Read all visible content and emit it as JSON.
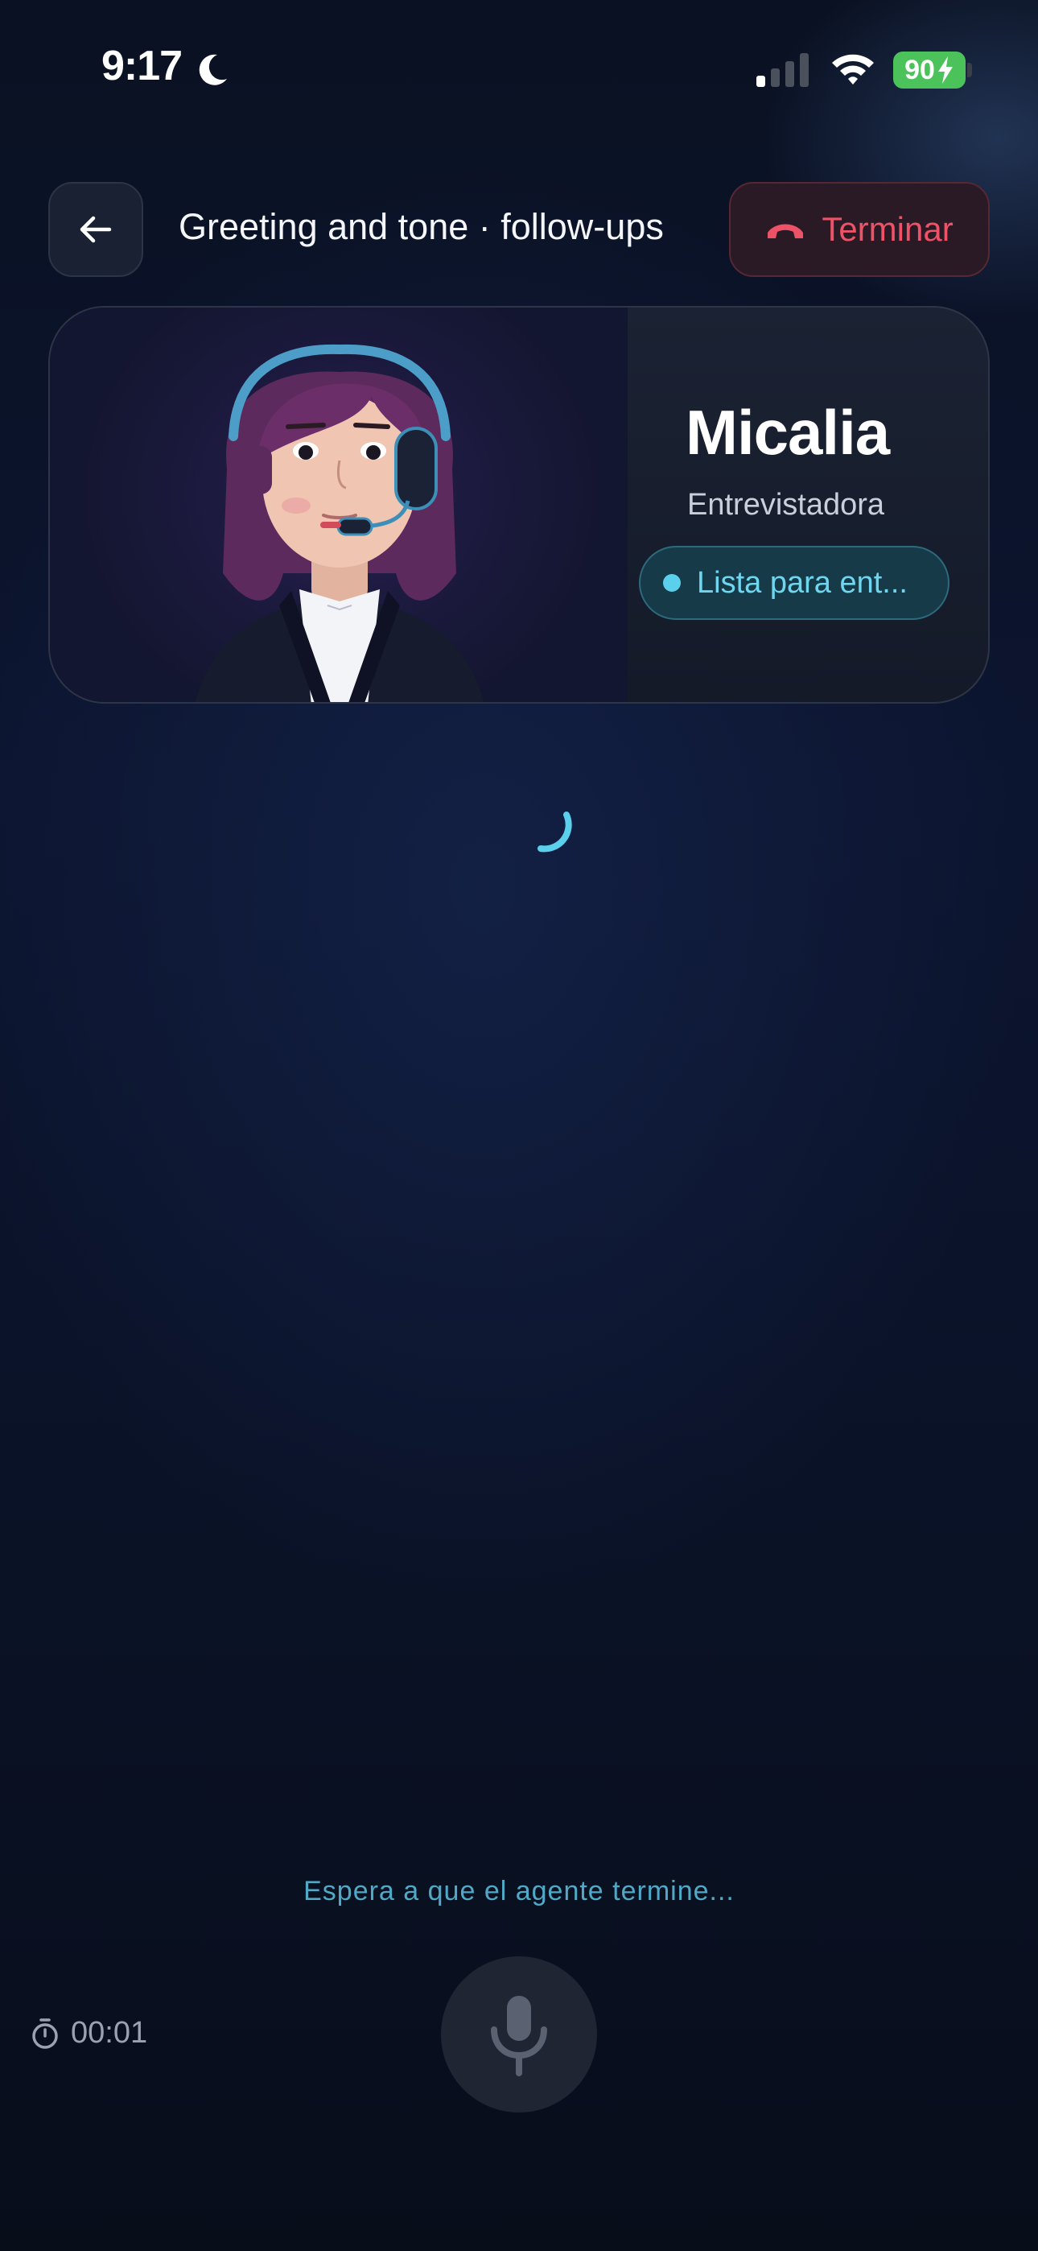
{
  "status_bar": {
    "time": "9:17",
    "battery": "90",
    "moon_icon": "moon-icon",
    "signal_icon": "signal-icon",
    "wifi_icon": "wifi-icon",
    "battery_charging": true
  },
  "header": {
    "back_icon": "arrow-left-icon",
    "title": "Greeting and tone · follow-ups",
    "end_label": "Terminar",
    "end_icon": "phone-hangup-icon",
    "end_color": "#ee5266"
  },
  "agent": {
    "name": "Micalia",
    "role": "Entrevistadora",
    "status": "Lista para ent...",
    "status_color": "#5ad0ec",
    "avatar": "avatar-illustration"
  },
  "loading": {
    "spinner_icon": "loading-spinner-icon",
    "accent": "#5ad0ec"
  },
  "footer": {
    "wait_message": "Espera a que el agente termine...",
    "timer": "00:01",
    "timer_icon": "stopwatch-icon",
    "mic_icon": "microphone-icon",
    "mic_enabled": false
  }
}
